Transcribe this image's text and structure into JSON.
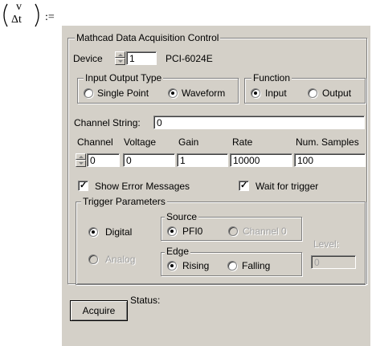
{
  "math": {
    "var_top": "v",
    "var_bottom": "Δt",
    "assign_op": ":="
  },
  "panel": {
    "title": "Mathcad Data Acquisition Control",
    "device_label": "Device",
    "device_value": "1",
    "device_name": "PCI-6024E",
    "io_type": {
      "legend": "Input Output Type",
      "options": [
        "Single Point",
        "Waveform"
      ],
      "selected": "Waveform"
    },
    "function": {
      "legend": "Function",
      "options": [
        "Input",
        "Output"
      ],
      "selected": "Input"
    },
    "channel_string_label": "Channel String:",
    "channel_string_value": "0",
    "columns": {
      "channel": "Channel",
      "voltage": "Voltage",
      "gain": "Gain",
      "rate": "Rate",
      "num_samples": "Num. Samples"
    },
    "values": {
      "channel": "0",
      "voltage": "0",
      "gain": "1",
      "rate": "10000",
      "num_samples": "100"
    },
    "show_error_messages_label": "Show Error Messages",
    "show_error_messages_checked": true,
    "wait_for_trigger_label": "Wait for trigger",
    "wait_for_trigger_checked": true,
    "trigger": {
      "legend": "Trigger Parameters",
      "type_options": [
        "Digital",
        "Analog"
      ],
      "type_selected": "Digital",
      "source": {
        "legend": "Source",
        "options": [
          "PFI0",
          "Channel 0"
        ],
        "selected": "PFI0"
      },
      "edge": {
        "legend": "Edge",
        "options": [
          "Rising",
          "Falling"
        ],
        "selected": "Rising"
      },
      "level_label": "Level:",
      "level_value": "0"
    },
    "acquire_label": "Acquire",
    "status_label": "Status:"
  }
}
